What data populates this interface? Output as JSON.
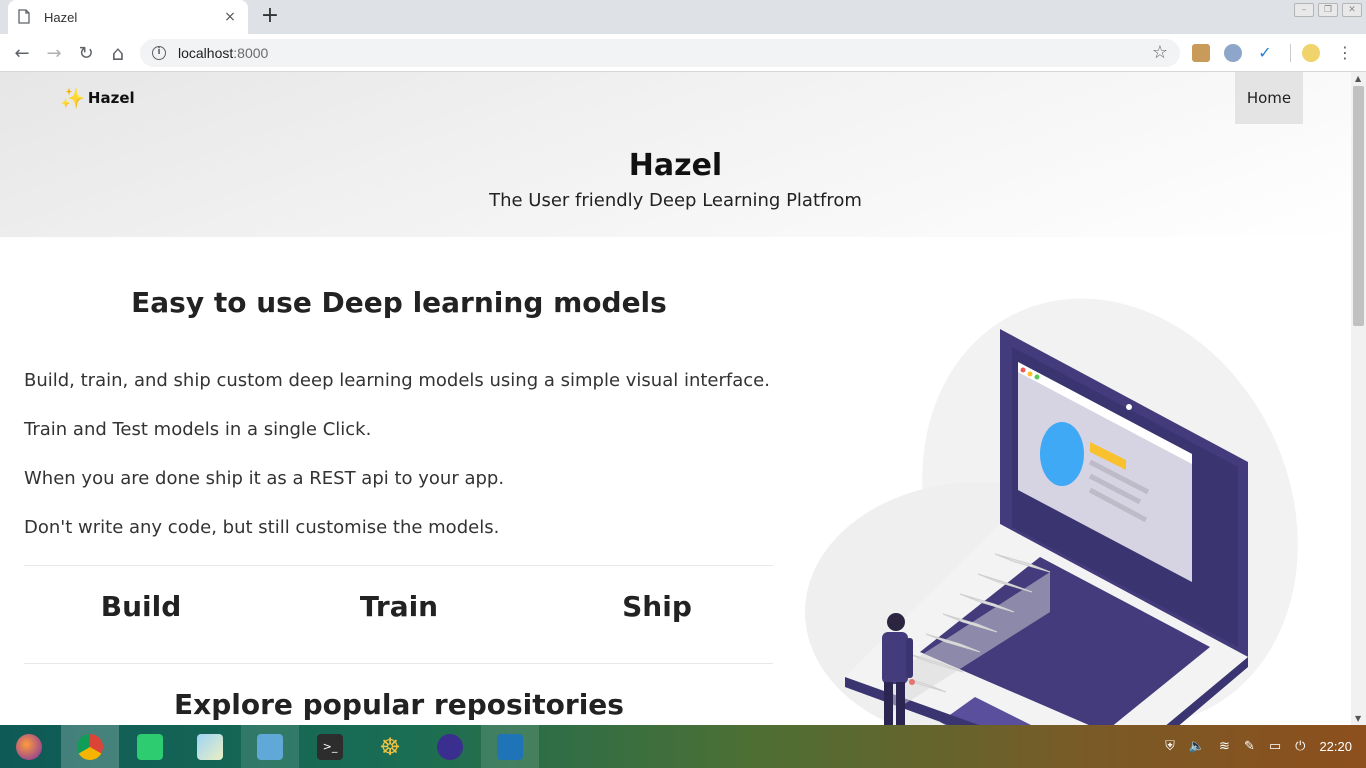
{
  "browser": {
    "tab_title": "Hazel",
    "tab_close": "×",
    "new_tab": "+",
    "url_host": "localhost",
    "url_port": ":8000",
    "star": "☆"
  },
  "nav": {
    "back": "←",
    "forward": "→",
    "reload": "↻",
    "home": "⌂"
  },
  "page": {
    "brand": "Hazel",
    "home_link": "Home",
    "hero_title": "Hazel",
    "hero_subtitle": "The User friendly Deep Learning Platfrom",
    "features_title": "Easy to use Deep learning models",
    "features": [
      "Build, train, and ship custom deep learning models using a simple visual interface.",
      "Train and Test models in a single Click.",
      "When you are done ship it as a REST api to your app.",
      "Don't write any code, but still customise the models."
    ],
    "steps": [
      "Build",
      "Train",
      "Ship"
    ],
    "explore_title": "Explore popular repositories"
  },
  "taskbar": {
    "clock": "22:20"
  },
  "colors": {
    "accent_purple": "#433b7c",
    "illustration_blue": "#3fa9f5",
    "illustration_yellow": "#f9c12e"
  }
}
